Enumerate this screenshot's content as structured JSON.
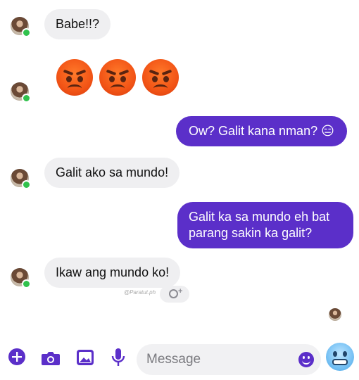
{
  "messages": [
    {
      "side": "in",
      "text": "Babe!!?"
    },
    {
      "side": "in",
      "emoji": [
        "angry-face",
        "angry-face",
        "angry-face"
      ]
    },
    {
      "side": "out",
      "text": "Ow? Galit kana nman? 😑"
    },
    {
      "side": "in",
      "text": "Galit ako sa mundo!"
    },
    {
      "side": "out",
      "text": "Galit ka sa mundo eh bat parang sakin ka galit?"
    },
    {
      "side": "in",
      "text": "Ikaw ang mundo ko!"
    }
  ],
  "watermark": "@Paratut.ph",
  "composer": {
    "placeholder": "Message",
    "icons": [
      "plus-icon",
      "camera-icon",
      "image-icon",
      "microphone-icon",
      "emoji-icon",
      "cold-face-emoji"
    ]
  },
  "colors": {
    "accent": "#5b2fc9",
    "incoming_bubble": "#efeff1",
    "online": "#31c24d"
  }
}
